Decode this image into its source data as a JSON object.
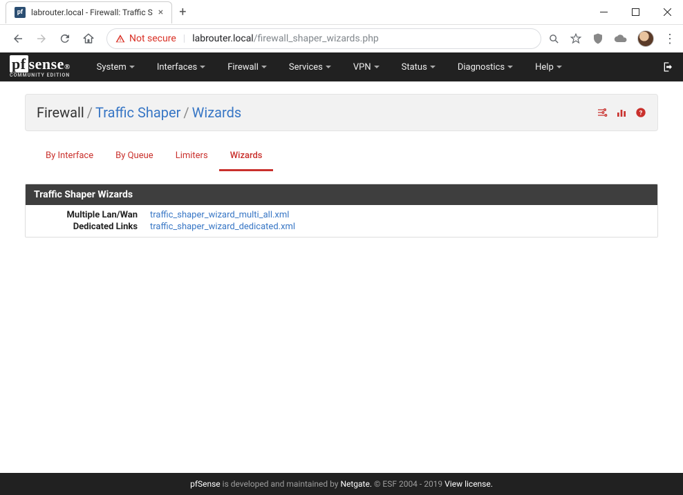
{
  "browser": {
    "tab_title": "labrouter.local - Firewall: Traffic S",
    "not_secure_label": "Not secure",
    "url_host": "labrouter.local",
    "url_path": "/firewall_shaper_wizards.php"
  },
  "nav": {
    "items": [
      "System",
      "Interfaces",
      "Firewall",
      "Services",
      "VPN",
      "Status",
      "Diagnostics",
      "Help"
    ]
  },
  "breadcrumb": {
    "part1": "Firewall",
    "part2": "Traffic Shaper",
    "part3": "Wizards"
  },
  "subtabs": {
    "items": [
      "By Interface",
      "By Queue",
      "Limiters",
      "Wizards"
    ],
    "active_index": 3
  },
  "panel": {
    "title": "Traffic Shaper Wizards",
    "rows": [
      {
        "label": "Multiple Lan/Wan",
        "link": "traffic_shaper_wizard_multi_all.xml"
      },
      {
        "label": "Dedicated Links",
        "link": "traffic_shaper_wizard_dedicated.xml"
      }
    ]
  },
  "footer": {
    "brand": "pfSense",
    "text1": " is developed and maintained by ",
    "netgate": "Netgate.",
    "text2": " © ESF 2004 - 2019 ",
    "view_license": "View license."
  }
}
